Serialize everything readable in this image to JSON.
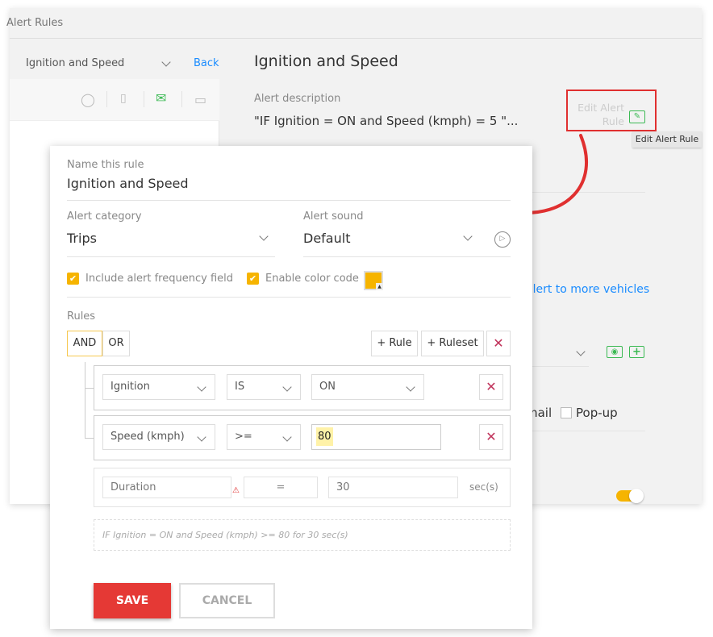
{
  "window": {
    "title": "Alert Rules"
  },
  "sidebar": {
    "selected_rule": "Ignition and Speed",
    "back_label": "Back",
    "icons": [
      "chat-icon",
      "mobile-icon",
      "email-icon",
      "message-icon"
    ]
  },
  "main": {
    "title": "Ignition and Speed",
    "desc_label": "Alert description",
    "desc_value": "\"IF Ignition = ON and Speed (kmph) = 5 \"...",
    "edit_label": "Edit Alert Rule",
    "tooltip": "Edit Alert Rule",
    "vehicles_link": "alert to more vehicles",
    "notify_email": "mail",
    "notify_popup": "Pop-up",
    "toggle_on": true
  },
  "modal": {
    "name_label": "Name this rule",
    "name_value": "Ignition and Speed",
    "category_label": "Alert category",
    "category_value": "Trips",
    "sound_label": "Alert sound",
    "sound_value": "Default",
    "freq_label": "Include alert frequency field",
    "freq_checked": true,
    "color_label": "Enable color code",
    "color_checked": true,
    "color_value": "#f6b400",
    "rules_label": "Rules",
    "and_label": "AND",
    "or_label": "OR",
    "add_rule": "+ Rule",
    "add_ruleset": "+ Ruleset",
    "rules": [
      {
        "field": "Ignition",
        "op": "IS",
        "value": "ON"
      },
      {
        "field": "Speed (kmph)",
        "op": ">=",
        "value": "80"
      }
    ],
    "duration": {
      "field": "Duration",
      "op": "=",
      "value": "30",
      "unit": "sec(s)"
    },
    "summary": "IF Ignition = ON and Speed (kmph) >= 80 for 30 sec(s)",
    "save": "SAVE",
    "cancel": "CANCEL"
  },
  "colors": {
    "accent": "#f6b400",
    "save": "#e53935",
    "link": "#1a8cff",
    "green": "#3cba54",
    "annotation": "#e03030"
  }
}
